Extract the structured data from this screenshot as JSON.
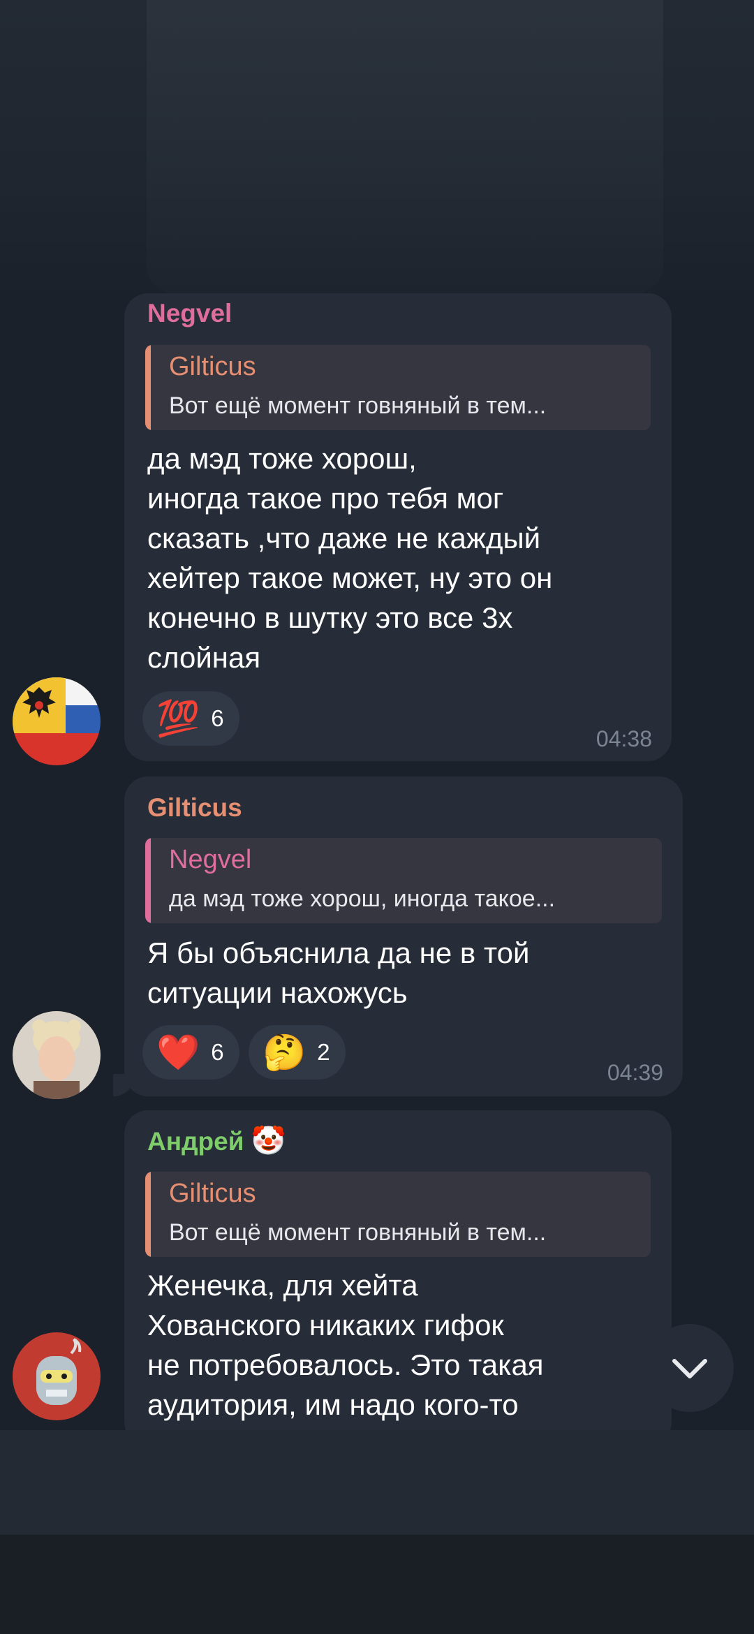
{
  "messages": [
    {
      "sender": "Negvel",
      "sender_color": "#e06e9c",
      "reply_to": {
        "name": "Gilticus",
        "text": "Вот ещё момент говняный в тем...",
        "color": "#e68f72"
      },
      "text": "да мэд тоже хорош,\nиногда такое про тебя мог\nсказать ,что даже не каждый\nхейтер такое может, ну это он\nконечно в шутку это все 3х\nслойная",
      "reactions": [
        {
          "emoji": "💯",
          "count": "6"
        }
      ],
      "time": "04:38"
    },
    {
      "sender": "Gilticus",
      "sender_color": "#e68f72",
      "reply_to": {
        "name": "Negvel",
        "text": "да мэд тоже хорош, иногда такое...",
        "color": "#e06e9c"
      },
      "text": "Я бы объяснила да не в той\nситуации нахожусь",
      "reactions": [
        {
          "emoji": "❤️",
          "count": "6"
        },
        {
          "emoji": "🤔",
          "count": "2"
        }
      ],
      "time": "04:39"
    },
    {
      "sender": "Андрей",
      "sender_badge": "🤡",
      "sender_color": "#7fcc6b",
      "reply_to": {
        "name": "Gilticus",
        "text": "Вот ещё момент говняный в тем...",
        "color": "#e68f72"
      },
      "text": "Женечка, для хейта\nХованского никаких гифок\nне потребовалось. Это такая\nаудитория, им надо кого-то"
    }
  ],
  "scroll_down_icon": "chevron-down-icon"
}
